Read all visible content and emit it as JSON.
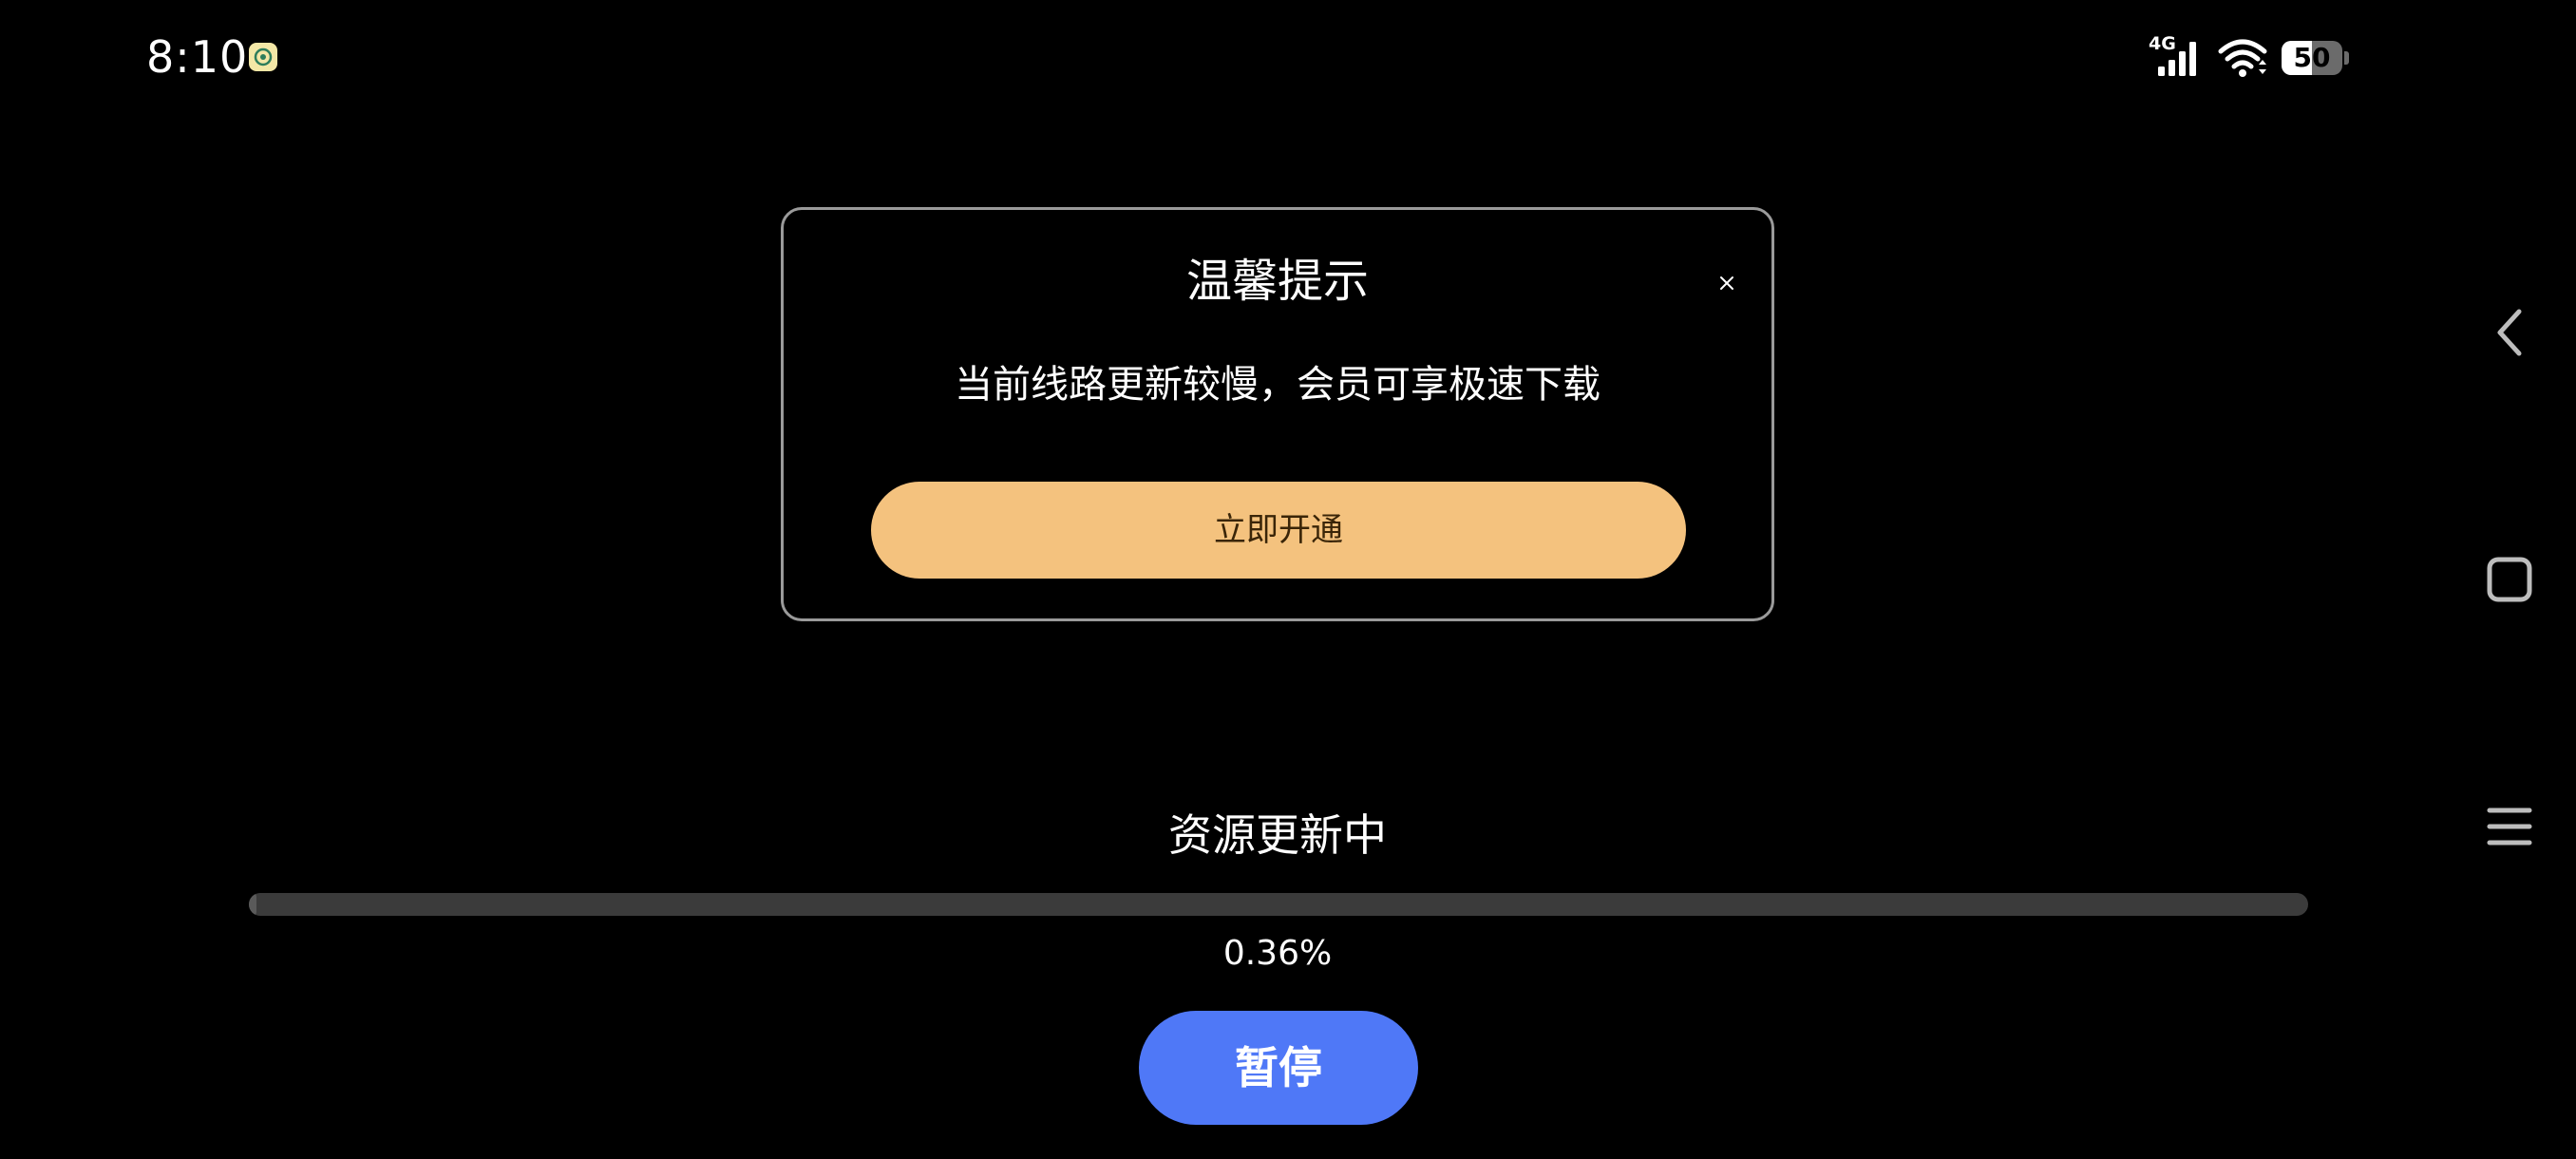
{
  "status_bar": {
    "time": "8:10",
    "network_label": "4G",
    "battery_level": "50",
    "battery_fraction": 0.5
  },
  "dialog": {
    "title": "温馨提示",
    "message": "当前线路更新较慢，会员可享极速下载",
    "action_label": "立即开通"
  },
  "progress": {
    "title": "资源更新中",
    "percent_text": "0.36%",
    "fraction": 0.0036
  },
  "controls": {
    "pause_label": "暂停"
  },
  "colors": {
    "background": "#000000",
    "dialog_border": "#9a9a9a",
    "action_button": "#f4c27e",
    "pause_button": "#4f78f7",
    "progress_track": "#3b3b3b"
  },
  "icons": {
    "status_app": "app-notification-icon",
    "signal": "cellular-signal-icon",
    "wifi": "wifi-icon",
    "battery": "battery-icon",
    "close": "close-icon",
    "back": "back-chevron-icon",
    "home": "home-square-icon",
    "menu": "menu-lines-icon"
  }
}
